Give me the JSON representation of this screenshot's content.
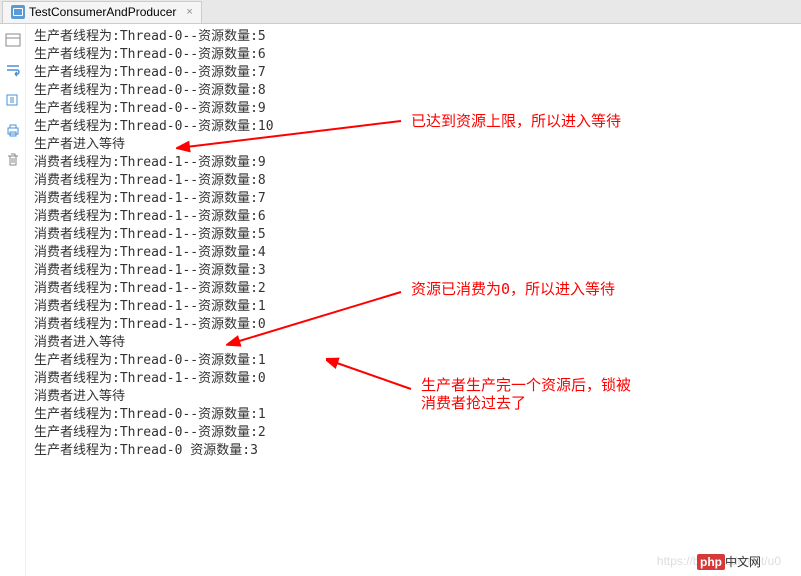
{
  "tab": {
    "label": "TestConsumerAndProducer",
    "close": "×"
  },
  "lines": [
    "生产者线程为:Thread-0--资源数量:5",
    "生产者线程为:Thread-0--资源数量:6",
    "生产者线程为:Thread-0--资源数量:7",
    "生产者线程为:Thread-0--资源数量:8",
    "生产者线程为:Thread-0--资源数量:9",
    "生产者线程为:Thread-0--资源数量:10",
    "生产者进入等待",
    "消费者线程为:Thread-1--资源数量:9",
    "消费者线程为:Thread-1--资源数量:8",
    "消费者线程为:Thread-1--资源数量:7",
    "消费者线程为:Thread-1--资源数量:6",
    "消费者线程为:Thread-1--资源数量:5",
    "消费者线程为:Thread-1--资源数量:4",
    "消费者线程为:Thread-1--资源数量:3",
    "消费者线程为:Thread-1--资源数量:2",
    "消费者线程为:Thread-1--资源数量:1",
    "消费者线程为:Thread-1--资源数量:0",
    "消费者进入等待",
    "生产者线程为:Thread-0--资源数量:1",
    "消费者线程为:Thread-1--资源数量:0",
    "消费者进入等待",
    "生产者线程为:Thread-0--资源数量:1",
    "生产者线程为:Thread-0--资源数量:2",
    "生产者线程为:Thread-0   资源数量:3"
  ],
  "annotations": {
    "a1": "已达到资源上限，所以进入等待",
    "a2": "资源已消费为0，所以进入等待",
    "a3_line1": "生产者生产完一个资源后，锁被",
    "a3_line2": "消费者抢过去了"
  },
  "watermark": "https://blog.csdn.net/u0",
  "logo": {
    "php": "php",
    "cn": "中文网"
  }
}
